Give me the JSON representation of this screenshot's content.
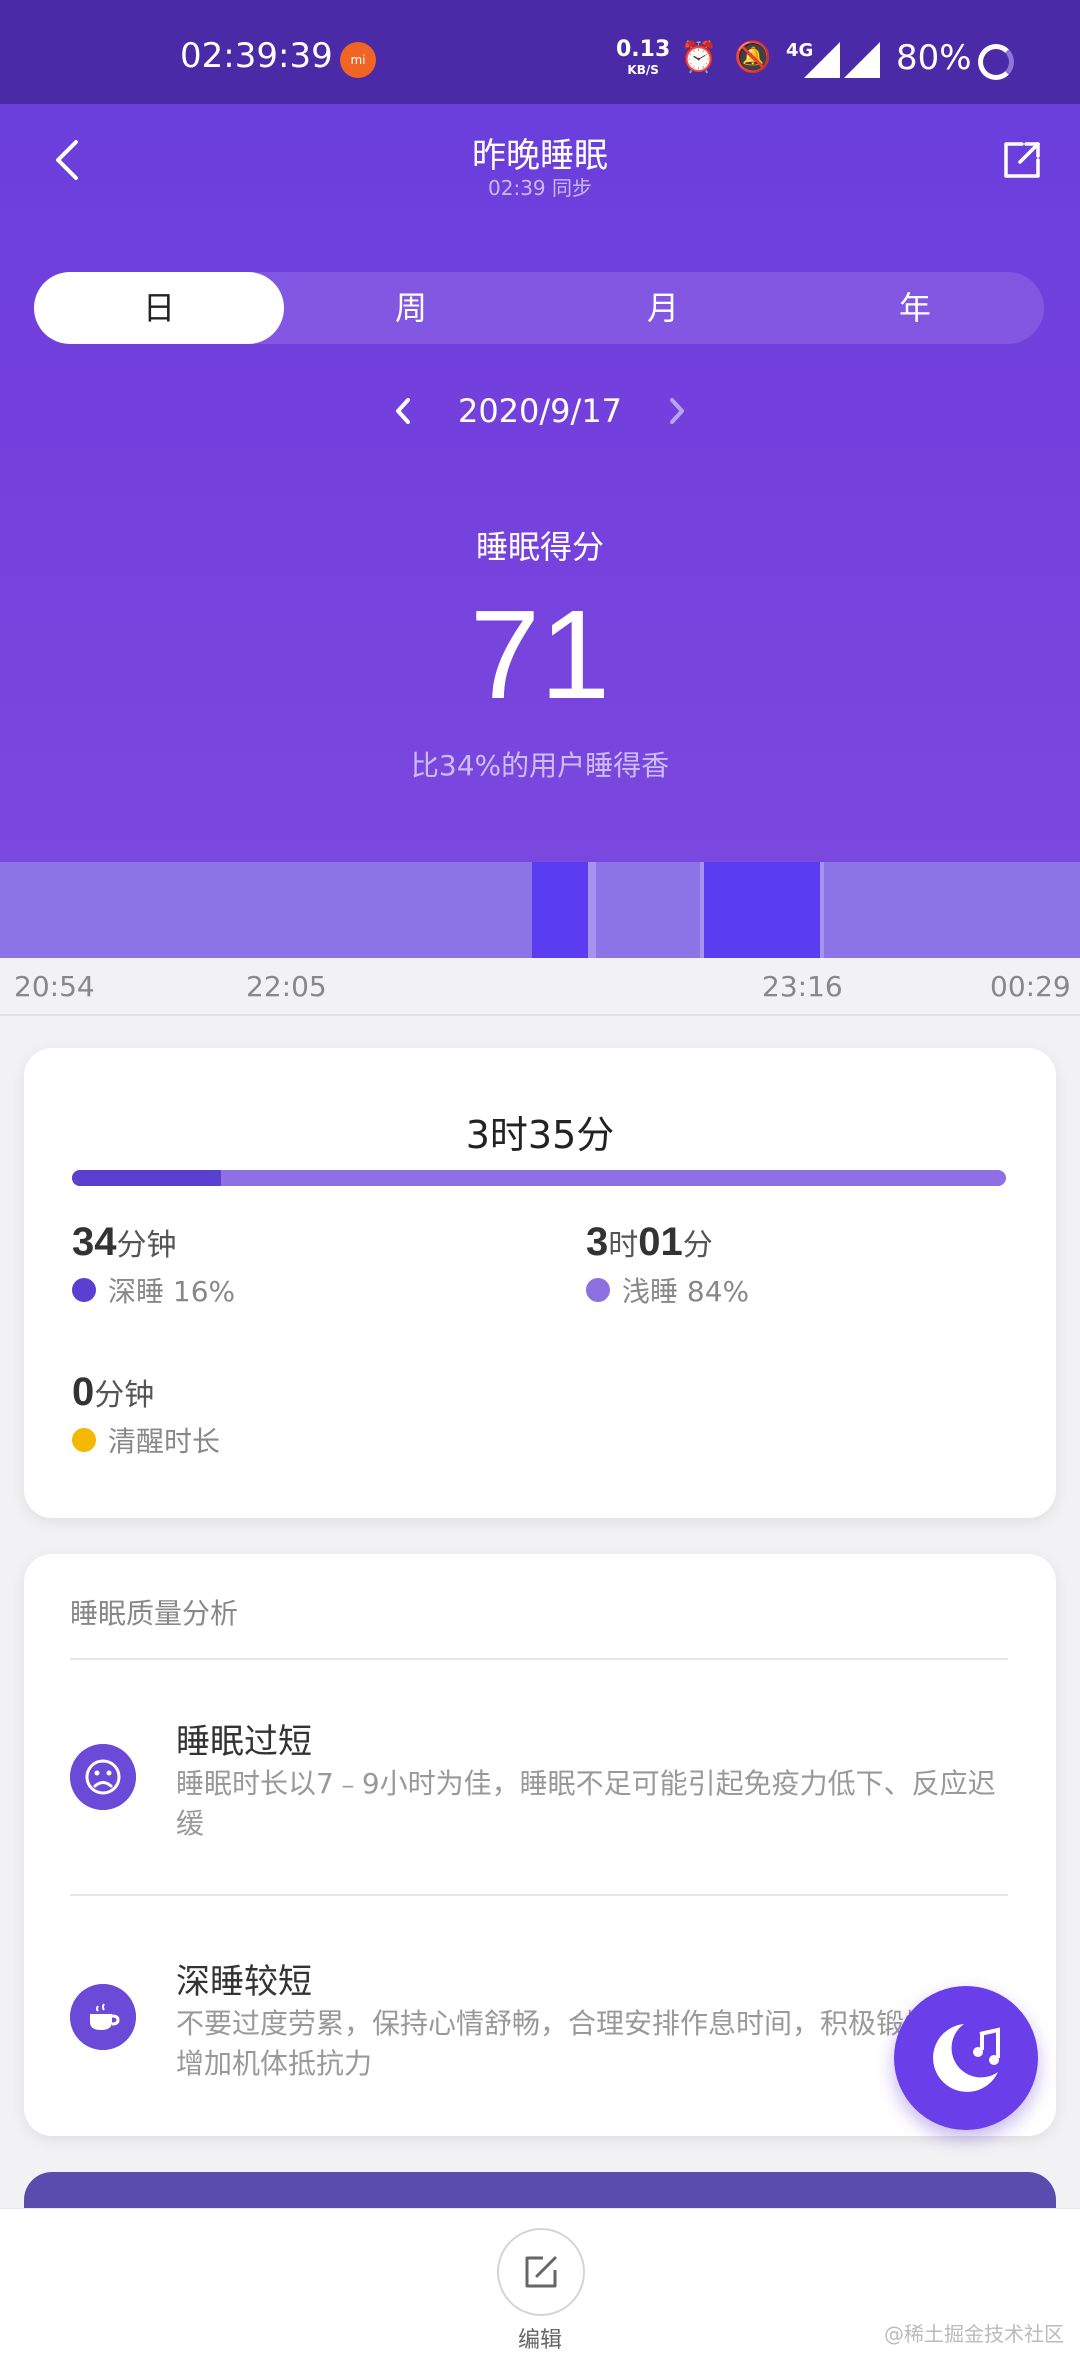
{
  "status_bar": {
    "time": "02:39:39",
    "net_speed": "0.13",
    "net_unit": "KB/S",
    "network": "4G",
    "battery": "80%",
    "mi_badge": "mi"
  },
  "header": {
    "title": "昨晚睡眠",
    "subtitle": "02:39 同步",
    "back_icon": "chevron-left-icon",
    "share_icon": "share-external-icon"
  },
  "tabs": [
    {
      "label": "日",
      "active": true
    },
    {
      "label": "周",
      "active": false
    },
    {
      "label": "月",
      "active": false
    },
    {
      "label": "年",
      "active": false
    }
  ],
  "date_nav": {
    "date": "2020/9/17",
    "prev_icon": "chevron-left-icon",
    "next_icon": "chevron-right-icon"
  },
  "score": {
    "label": "睡眠得分",
    "value": "71",
    "comparison": "比34%的用户睡得香"
  },
  "timeline": {
    "ticks": [
      "20:54",
      "22:05",
      "23:16",
      "00:29"
    ],
    "colors": {
      "light": "#8d74e6",
      "deep": "#5b3df1"
    }
  },
  "summary": {
    "total": "3时35分",
    "deep_fraction": 0.16,
    "deep": {
      "num": "34",
      "unit": "分钟",
      "label": "深睡 16%",
      "color": "#5a3fd0"
    },
    "light": {
      "num_h": "3",
      "unit_h": "时",
      "num_m": "01",
      "unit_m": "分",
      "label": "浅睡 84%",
      "color": "#8d6fe0"
    },
    "awake": {
      "num": "0",
      "unit": "分钟",
      "label": "清醒时长",
      "color": "#f5b800"
    }
  },
  "analysis": {
    "title": "睡眠质量分析",
    "items": [
      {
        "icon": "sad-face-icon",
        "heading": "睡眠过短",
        "desc": "睡眠时长以7﹣9小时为佳，睡眠不足可能引起免疫力低下、反应迟缓"
      },
      {
        "icon": "coffee-cup-icon",
        "heading": "深睡较短",
        "desc": "不要过度劳累，保持心情舒畅，合理安排作息时间，积极锻炼身体增加机体抵抗力"
      }
    ]
  },
  "bottom": {
    "edit_label": "编辑",
    "edit_icon": "edit-icon",
    "watermark": "@稀土掘金技术社区"
  },
  "fab": {
    "icon": "moon-music-icon"
  }
}
